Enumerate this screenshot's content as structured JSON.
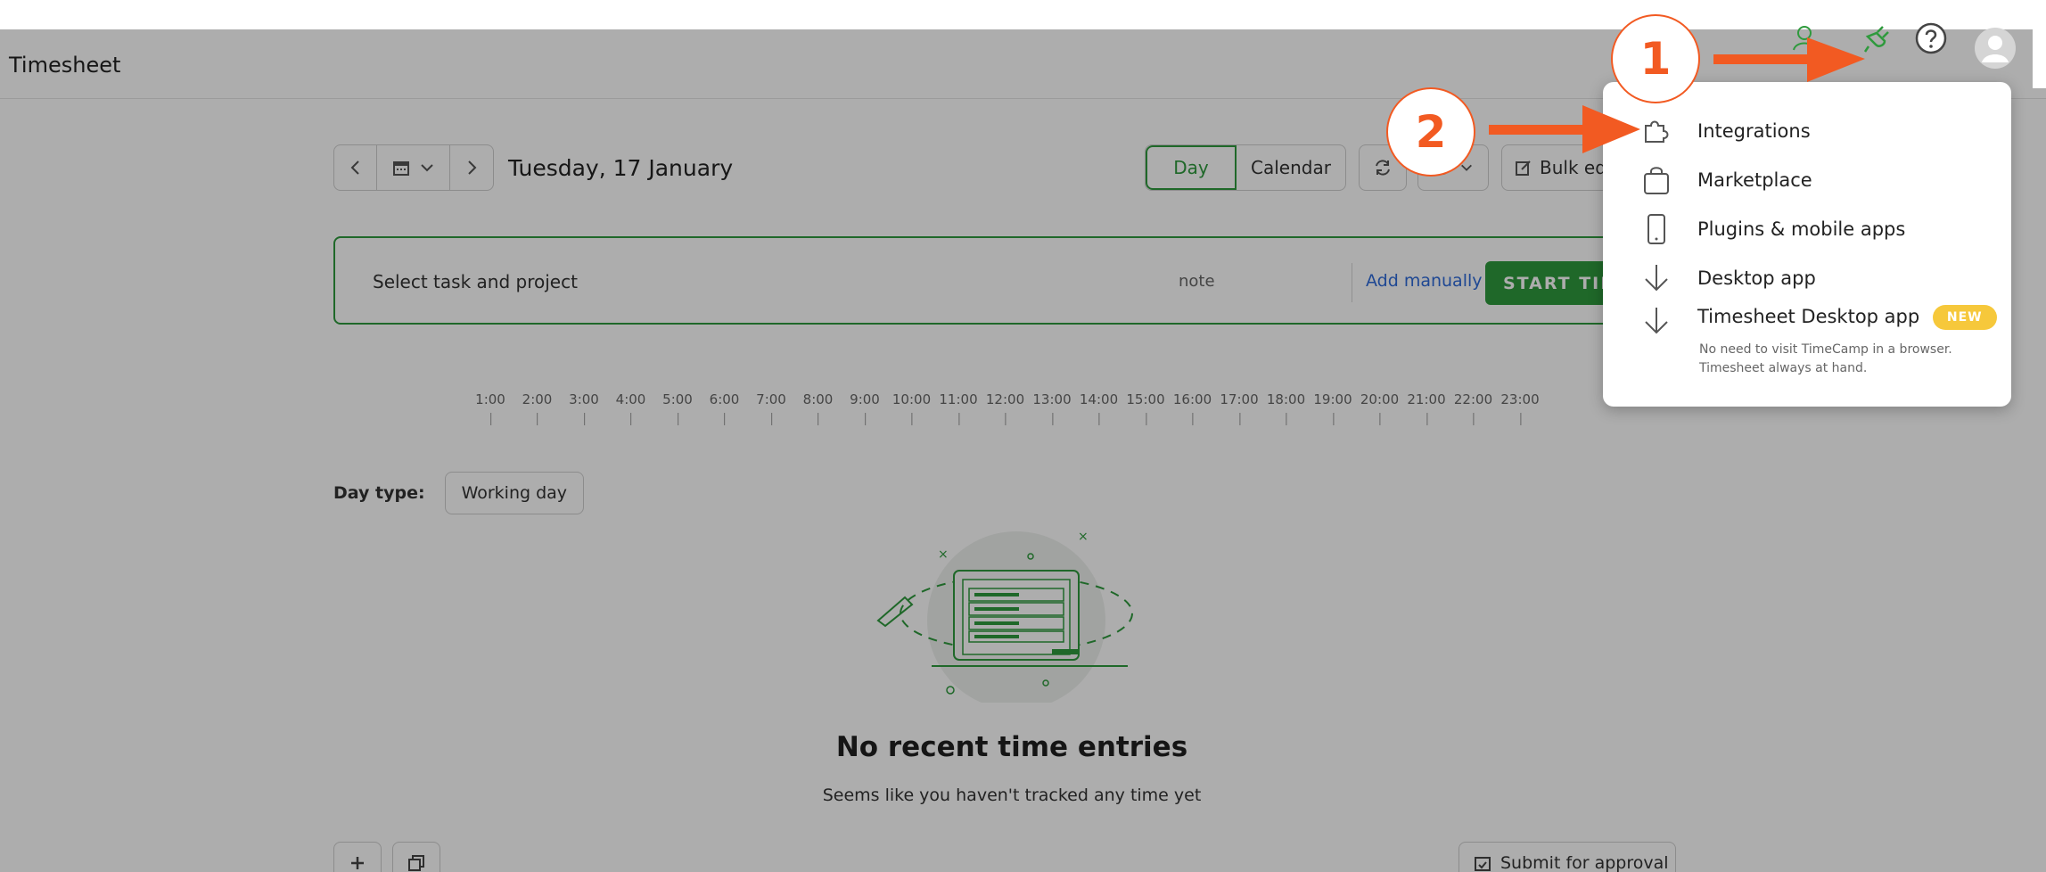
{
  "page": {
    "title": "Timesheet"
  },
  "nav": {
    "date": "Tuesday, 17 January"
  },
  "views": {
    "day": "Day",
    "calendar": "Calendar"
  },
  "toolbar": {
    "bulk_edit": "Bulk edi"
  },
  "entry": {
    "task_placeholder": "Select task and project",
    "note_placeholder": "note",
    "add_manually": "Add manually",
    "start_timer": "START TIME"
  },
  "timeline": {
    "hours": [
      "1:00",
      "2:00",
      "3:00",
      "4:00",
      "5:00",
      "6:00",
      "7:00",
      "8:00",
      "9:00",
      "10:00",
      "11:00",
      "12:00",
      "13:00",
      "14:00",
      "15:00",
      "16:00",
      "17:00",
      "18:00",
      "19:00",
      "20:00",
      "21:00",
      "22:00",
      "23:00"
    ]
  },
  "day_type": {
    "label": "Day type:",
    "value": "Working day"
  },
  "empty_state": {
    "title": "No recent time entries",
    "subtitle": "Seems like you haven't tracked any time yet"
  },
  "footer": {
    "submit": "Submit for approval"
  },
  "dropdown": {
    "items": [
      {
        "label": "Integrations",
        "icon": "puzzle-icon"
      },
      {
        "label": "Marketplace",
        "icon": "shopping-bag-icon"
      },
      {
        "label": "Plugins & mobile apps",
        "icon": "phone-icon"
      },
      {
        "label": "Desktop app",
        "icon": "download-arrow-icon"
      },
      {
        "label": "Timesheet Desktop app",
        "icon": "download-arrow-icon",
        "badge": "NEW",
        "description": "No need to visit TimeCamp in a browser. Timesheet always at hand."
      }
    ]
  },
  "callouts": {
    "one": "1",
    "two": "2"
  },
  "colors": {
    "accent": "#2f9a3d",
    "callout": "#f25a22",
    "badge": "#f6c83b",
    "link": "#2f6ad9"
  }
}
